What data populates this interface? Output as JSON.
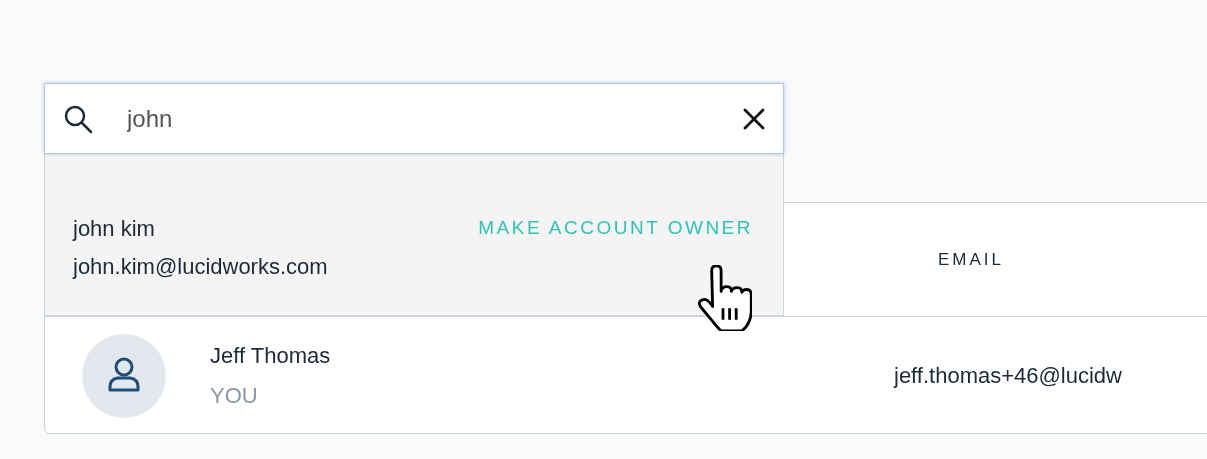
{
  "search": {
    "value": "john"
  },
  "suggestions": [
    {
      "name": "john kim",
      "email": "john.kim@lucidworks.com",
      "action": "MAKE ACCOUNT OWNER"
    }
  ],
  "table": {
    "columns": [
      {
        "label": "EMAIL"
      }
    ],
    "rows": [
      {
        "name": "Jeff Thomas",
        "badge": "YOU",
        "email": "jeff.thomas+46@lucidw"
      }
    ]
  }
}
